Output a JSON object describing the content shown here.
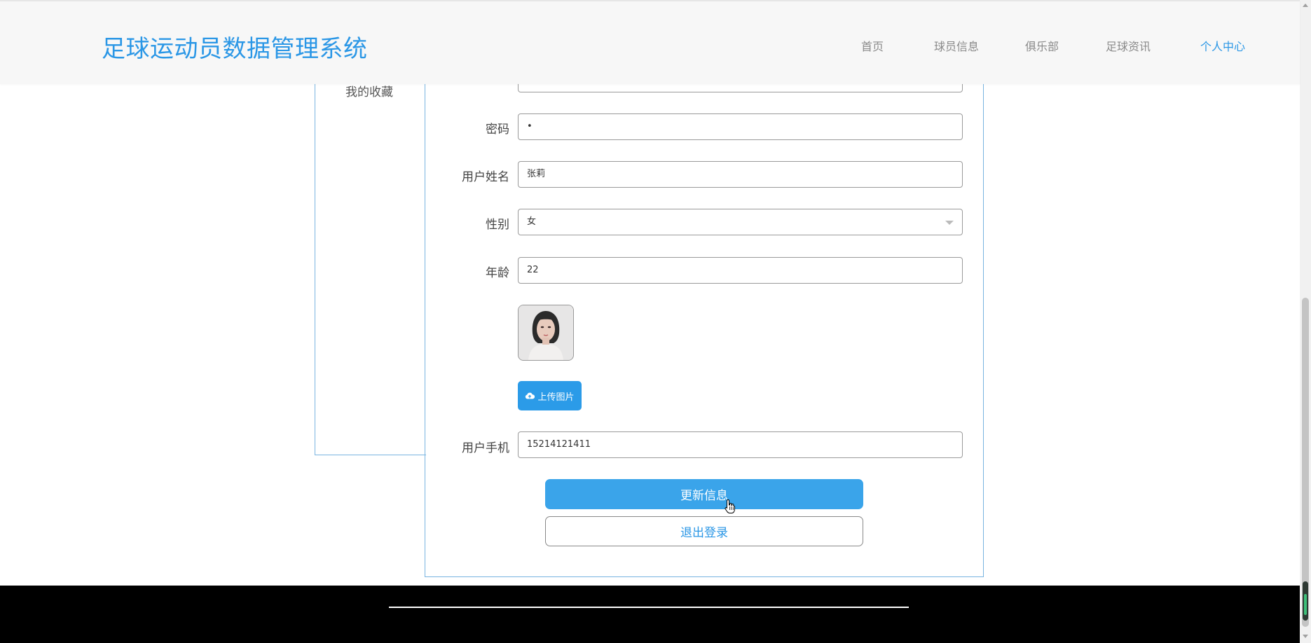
{
  "header": {
    "title": "足球运动员数据管理系统",
    "nav": [
      {
        "label": "首页",
        "active": false
      },
      {
        "label": "球员信息",
        "active": false
      },
      {
        "label": "俱乐部",
        "active": false
      },
      {
        "label": "足球资讯",
        "active": false
      },
      {
        "label": "个人中心",
        "active": true
      }
    ]
  },
  "sidebar": {
    "items": [
      {
        "label": "我的收藏"
      }
    ]
  },
  "form": {
    "password": {
      "label": "密码",
      "value": "•"
    },
    "name": {
      "label": "用户姓名",
      "value": "张莉"
    },
    "gender": {
      "label": "性别",
      "value": "女"
    },
    "age": {
      "label": "年龄",
      "value": "22"
    },
    "upload_label": "上传图片",
    "phone": {
      "label": "用户手机",
      "value": "15214121411"
    },
    "update_label": "更新信息",
    "logout_label": "退出登录"
  },
  "colors": {
    "accent": "#2b97e6",
    "button": "#3aa4ea",
    "footer": "#000000"
  }
}
